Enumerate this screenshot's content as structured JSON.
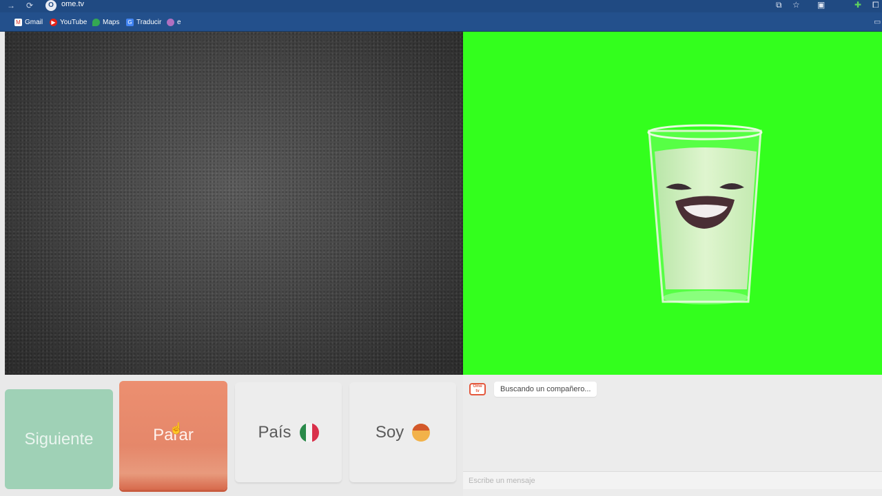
{
  "browser": {
    "url": "ome.tv",
    "favicon_label": "O",
    "bookmarks": [
      {
        "label": "Gmail",
        "icon": "gmail-icon",
        "color": "#ffffff"
      },
      {
        "label": "YouTube",
        "icon": "youtube-icon",
        "color": "#e62117"
      },
      {
        "label": "Maps",
        "icon": "maps-icon",
        "color": "#34a853"
      },
      {
        "label": "Traducir",
        "icon": "translate-icon",
        "color": "#4285f4"
      },
      {
        "label": "e",
        "icon": "bookmark-icon",
        "color": "#b070c0"
      }
    ]
  },
  "video": {
    "partner_bg": "#33ff1d"
  },
  "controls": {
    "next_label": "Siguiente",
    "stop_label": "Parar",
    "country_label": "País",
    "country_flag": "mexico-flag",
    "gender_label": "Soy",
    "gender_icon": "boy-emoji"
  },
  "chat": {
    "logo_text": "Ome tv",
    "status_message": "Buscando un compañero...",
    "input_placeholder": "Escribe un mensaje"
  },
  "colors": {
    "next": "#9fd1b6",
    "stop": "#e5876a",
    "topbar": "#204a82"
  }
}
